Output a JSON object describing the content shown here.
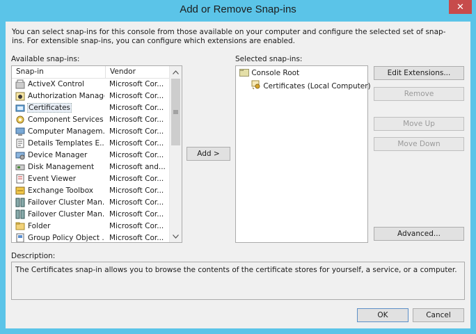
{
  "window": {
    "title": "Add or Remove Snap-ins",
    "close_glyph": "✕"
  },
  "intro": "You can select snap-ins for this console from those available on your computer and configure the selected set of snap-ins. For extensible snap-ins, you can configure which extensions are enabled.",
  "available": {
    "label": "Available snap-ins:",
    "columns": [
      "Snap-in",
      "Vendor"
    ],
    "rows": [
      {
        "name": "ActiveX Control",
        "vendor": "Microsoft Cor...",
        "icon": "activex-icon"
      },
      {
        "name": "Authorization Manager",
        "vendor": "Microsoft Cor...",
        "icon": "authorization-icon"
      },
      {
        "name": "Certificates",
        "vendor": "Microsoft Cor...",
        "icon": "certificates-icon",
        "selected": true
      },
      {
        "name": "Component Services",
        "vendor": "Microsoft Cor...",
        "icon": "component-services-icon"
      },
      {
        "name": "Computer Managem...",
        "vendor": "Microsoft Cor...",
        "icon": "computer-management-icon"
      },
      {
        "name": "Details Templates E...",
        "vendor": "Microsoft Cor...",
        "icon": "details-templates-icon"
      },
      {
        "name": "Device Manager",
        "vendor": "Microsoft Cor...",
        "icon": "device-manager-icon"
      },
      {
        "name": "Disk Management",
        "vendor": "Microsoft and...",
        "icon": "disk-management-icon"
      },
      {
        "name": "Event Viewer",
        "vendor": "Microsoft Cor...",
        "icon": "event-viewer-icon"
      },
      {
        "name": "Exchange Toolbox",
        "vendor": "Microsoft Cor...",
        "icon": "exchange-toolbox-icon"
      },
      {
        "name": "Failover Cluster Man...",
        "vendor": "Microsoft Cor...",
        "icon": "failover-cluster-icon"
      },
      {
        "name": "Failover Cluster Man...",
        "vendor": "Microsoft Cor...",
        "icon": "failover-cluster-icon"
      },
      {
        "name": "Folder",
        "vendor": "Microsoft Cor...",
        "icon": "folder-icon"
      },
      {
        "name": "Group Policy Object ...",
        "vendor": "Microsoft Cor...",
        "icon": "group-policy-icon"
      }
    ]
  },
  "add_button": "Add >",
  "selected": {
    "label": "Selected snap-ins:",
    "root": "Console Root",
    "child": "Certificates (Local Computer)"
  },
  "buttons": {
    "edit_extensions": "Edit Extensions...",
    "remove": "Remove",
    "move_up": "Move Up",
    "move_down": "Move Down",
    "advanced": "Advanced..."
  },
  "description": {
    "label": "Description:",
    "text": "The Certificates snap-in allows you to browse the contents of the certificate stores for yourself, a service, or a computer."
  },
  "footer": {
    "ok": "OK",
    "cancel": "Cancel"
  },
  "colors": {
    "titlebar": "#5bc4e8",
    "close": "#c74b4b",
    "dialog_bg": "#f0f0f0"
  }
}
